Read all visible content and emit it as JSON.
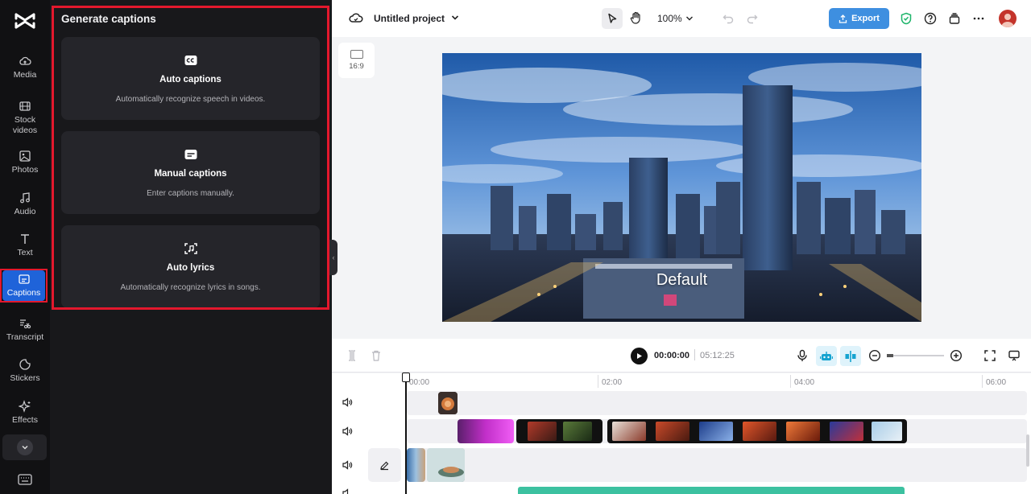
{
  "sidebar": {
    "items": [
      {
        "label": "Media",
        "icon": "cloud-upload-icon"
      },
      {
        "label": "Stock\nvideos",
        "icon": "film-icon"
      },
      {
        "label": "Photos",
        "icon": "image-icon"
      },
      {
        "label": "Audio",
        "icon": "music-note-icon"
      },
      {
        "label": "Text",
        "icon": "text-t-icon"
      },
      {
        "label": "Captions",
        "icon": "captions-icon",
        "active": true
      },
      {
        "label": "Transcript",
        "icon": "transcript-icon"
      },
      {
        "label": "Stickers",
        "icon": "sticker-icon"
      },
      {
        "label": "Effects",
        "icon": "sparkle-icon"
      }
    ]
  },
  "panel": {
    "title": "Generate captions",
    "cards": [
      {
        "title": "Auto captions",
        "description": "Automatically recognize speech in videos.",
        "icon": "cc-icon"
      },
      {
        "title": "Manual captions",
        "description": "Enter captions manually.",
        "icon": "subtitle-box-icon"
      },
      {
        "title": "Auto lyrics",
        "description": "Automatically recognize lyrics in songs.",
        "icon": "music-scan-icon"
      }
    ]
  },
  "topbar": {
    "project_title": "Untitled project",
    "zoom": "100%",
    "export_label": "Export"
  },
  "preview": {
    "aspect_ratio": "16:9",
    "caption_text": "Default"
  },
  "timeline": {
    "current_time": "00:00:00",
    "total_time": "05:12:25",
    "ruler": [
      "00:00",
      "02:00",
      "04:00",
      "06:00"
    ]
  },
  "colors": {
    "accent": "#3e8fe0",
    "active_rail": "#1f63d9",
    "highlight_outline": "#e3182d",
    "panel_bg": "#18181b"
  }
}
